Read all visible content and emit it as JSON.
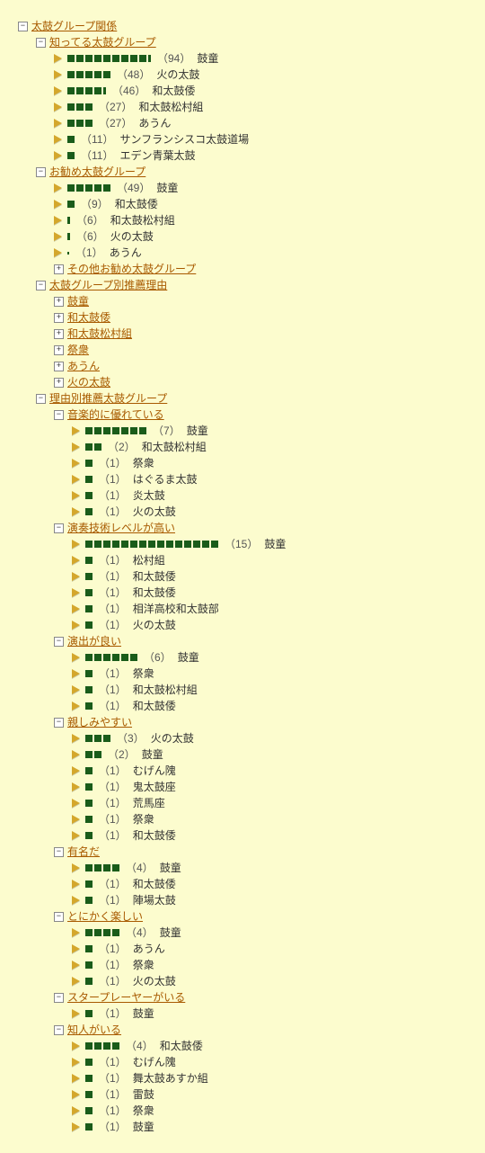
{
  "title": "太鼓グループ関係",
  "sections": [
    {
      "label": "知ってる太鼓グループ",
      "expanded": true,
      "items": [
        {
          "bars": 9,
          "half": 1,
          "count": 94,
          "name": "鼓童"
        },
        {
          "bars": 5,
          "half": 0,
          "count": 48,
          "name": "火の太鼓"
        },
        {
          "bars": 4,
          "half": 1,
          "count": 46,
          "name": "和太鼓倭"
        },
        {
          "bars": 3,
          "half": 0,
          "count": 27,
          "name": "和太鼓松村組"
        },
        {
          "bars": 3,
          "half": 0,
          "count": 27,
          "name": "あうん"
        },
        {
          "bars": 1,
          "half": 0,
          "count": 11,
          "name": "サンフランシスコ太鼓道場"
        },
        {
          "bars": 1,
          "half": 0,
          "count": 11,
          "name": "エデン青葉太鼓"
        }
      ]
    },
    {
      "label": "お勧め太鼓グループ",
      "expanded": true,
      "items": [
        {
          "bars": 5,
          "half": 0,
          "count": 49,
          "name": "鼓童"
        },
        {
          "bars": 1,
          "half": 0,
          "count": 9,
          "name": "和太鼓倭"
        },
        {
          "bars": 0,
          "half": 1,
          "count": 6,
          "name": "和太鼓松村組"
        },
        {
          "bars": 0,
          "half": 1,
          "count": 6,
          "name": "火の太鼓"
        },
        {
          "bars": 0,
          "half": 0,
          "dot": 1,
          "count": 1,
          "name": "あうん"
        }
      ],
      "extra": {
        "label": "その他お勧め太鼓グループ",
        "expanded": false
      }
    },
    {
      "label": "太鼓グループ別推薦理由",
      "expanded": true,
      "subgroups": [
        {
          "label": "鼓童"
        },
        {
          "label": "和太鼓倭"
        },
        {
          "label": "和太鼓松村組"
        },
        {
          "label": "祭衆"
        },
        {
          "label": "あうん"
        },
        {
          "label": "火の太鼓"
        }
      ]
    },
    {
      "label": "理由別推薦太鼓グループ",
      "expanded": true,
      "categories": [
        {
          "label": "音楽的に優れている",
          "items": [
            {
              "bars": 7,
              "count": 7,
              "name": "鼓童"
            },
            {
              "bars": 2,
              "count": 2,
              "name": "和太鼓松村組"
            },
            {
              "bars": 1,
              "count": 1,
              "name": "祭衆"
            },
            {
              "bars": 1,
              "count": 1,
              "name": "はぐるま太鼓"
            },
            {
              "bars": 1,
              "count": 1,
              "name": "炎太鼓"
            },
            {
              "bars": 1,
              "count": 1,
              "name": "火の太鼓"
            }
          ]
        },
        {
          "label": "演奏技術レベルが高い",
          "items": [
            {
              "bars": 15,
              "count": 15,
              "name": "鼓童"
            },
            {
              "bars": 1,
              "count": 1,
              "name": "松村組"
            },
            {
              "bars": 1,
              "count": 1,
              "name": "和太鼓倭"
            },
            {
              "bars": 1,
              "count": 1,
              "name": "和太鼓倭"
            },
            {
              "bars": 1,
              "count": 1,
              "name": "相洋高校和太鼓部"
            },
            {
              "bars": 1,
              "count": 1,
              "name": "火の太鼓"
            }
          ]
        },
        {
          "label": "演出が良い",
          "items": [
            {
              "bars": 6,
              "count": 6,
              "name": "鼓童"
            },
            {
              "bars": 1,
              "count": 1,
              "name": "祭衆"
            },
            {
              "bars": 1,
              "count": 1,
              "name": "和太鼓松村組"
            },
            {
              "bars": 1,
              "count": 1,
              "name": "和太鼓倭"
            }
          ]
        },
        {
          "label": "親しみやすい",
          "items": [
            {
              "bars": 3,
              "count": 3,
              "name": "火の太鼓"
            },
            {
              "bars": 2,
              "count": 2,
              "name": "鼓童"
            },
            {
              "bars": 1,
              "count": 1,
              "name": "むげん隗"
            },
            {
              "bars": 1,
              "count": 1,
              "name": "鬼太鼓座"
            },
            {
              "bars": 1,
              "count": 1,
              "name": "荒馬座"
            },
            {
              "bars": 1,
              "count": 1,
              "name": "祭衆"
            },
            {
              "bars": 1,
              "count": 1,
              "name": "和太鼓倭"
            }
          ]
        },
        {
          "label": "有名だ",
          "items": [
            {
              "bars": 4,
              "count": 4,
              "name": "鼓童"
            },
            {
              "bars": 1,
              "count": 1,
              "name": "和太鼓倭"
            },
            {
              "bars": 1,
              "count": 1,
              "name": "陣場太鼓"
            }
          ]
        },
        {
          "label": "とにかく楽しい",
          "items": [
            {
              "bars": 4,
              "count": 4,
              "name": "鼓童"
            },
            {
              "bars": 1,
              "count": 1,
              "name": "あうん"
            },
            {
              "bars": 1,
              "count": 1,
              "name": "祭衆"
            },
            {
              "bars": 1,
              "count": 1,
              "name": "火の太鼓"
            }
          ]
        },
        {
          "label": "スタープレーヤーがいる",
          "items": [
            {
              "bars": 1,
              "count": 1,
              "name": "鼓童"
            }
          ]
        },
        {
          "label": "知人がいる",
          "items": [
            {
              "bars": 4,
              "count": 4,
              "name": "和太鼓倭"
            },
            {
              "bars": 1,
              "count": 1,
              "name": "むげん隗"
            },
            {
              "bars": 1,
              "count": 1,
              "name": "舞太鼓あすか組"
            },
            {
              "bars": 1,
              "count": 1,
              "name": "雷鼓"
            },
            {
              "bars": 1,
              "count": 1,
              "name": "祭衆"
            },
            {
              "bars": 1,
              "count": 1,
              "name": "鼓童"
            }
          ]
        }
      ]
    }
  ]
}
